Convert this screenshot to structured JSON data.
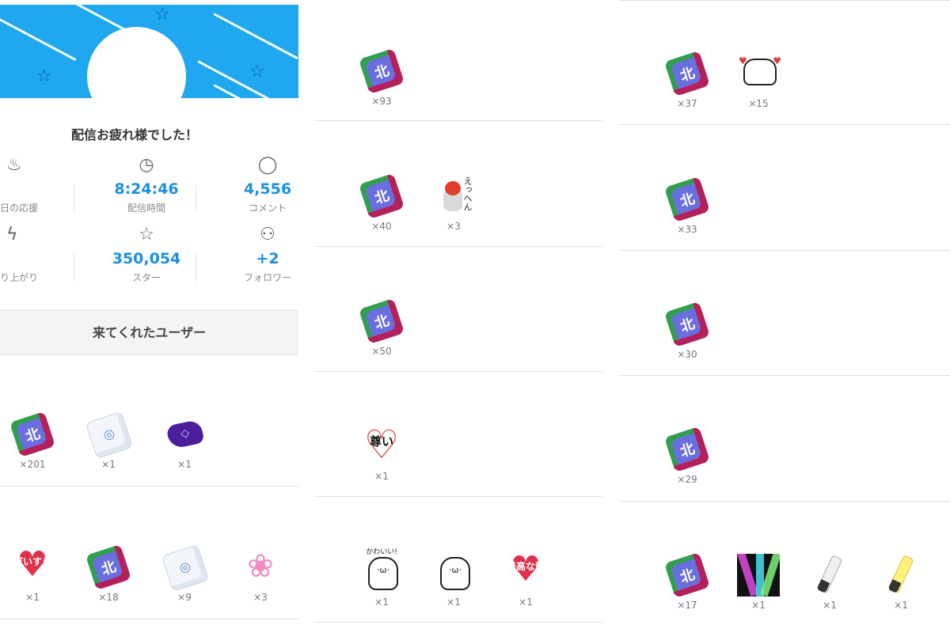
{
  "header": {
    "title": "配信お疲れ様でした！",
    "section_title": "来てくれたユーザー"
  },
  "stats": [
    {
      "icon": "flame-icon",
      "value": "",
      "label": "日の応援"
    },
    {
      "icon": "clock-icon",
      "value": "8:24:46",
      "label": "配信時間"
    },
    {
      "icon": "comment-icon",
      "value": "4,556",
      "label": "コメント"
    },
    {
      "icon": "bolt-icon",
      "value": "",
      "label": "り上がり"
    },
    {
      "icon": "star-icon",
      "value": "350,054",
      "label": "スター"
    },
    {
      "icon": "person-icon",
      "value": "+2",
      "label": "フォロワー"
    }
  ],
  "colors": {
    "banner": "#1fa7ef",
    "accent": "#1a8fe3"
  },
  "left_rows": [
    [
      {
        "type": "dice",
        "mark": "北",
        "count": "×201"
      },
      {
        "type": "dice-white",
        "count": "×1"
      },
      {
        "type": "pillow",
        "count": "×1"
      }
    ],
    [
      {
        "type": "heart-sticker",
        "text": "だいすき",
        "count": "×1"
      },
      {
        "type": "dice",
        "mark": "北",
        "count": "×18"
      },
      {
        "type": "dice-white",
        "count": "×9"
      },
      {
        "type": "lotus",
        "count": "×3"
      }
    ]
  ],
  "mid_rows": [
    [
      {
        "type": "dice",
        "mark": "北",
        "count": "×93"
      }
    ],
    [
      {
        "type": "dice",
        "mark": "北",
        "count": "×40"
      },
      {
        "type": "tengu",
        "text": "えっへん",
        "count": "×3"
      }
    ],
    [
      {
        "type": "dice",
        "mark": "北",
        "count": "×50"
      }
    ],
    [
      {
        "type": "heart-outline",
        "text": "尊い",
        "count": "×1"
      }
    ],
    [
      {
        "type": "cat-sticker",
        "text": "かわいい!",
        "count": "×1"
      },
      {
        "type": "cat-sticker",
        "text": "",
        "count": "×1"
      },
      {
        "type": "heart-sticker",
        "text": "最高な愛",
        "count": "×1"
      }
    ]
  ],
  "right_rows": [
    [
      {
        "type": "dice",
        "mark": "北",
        "count": "×37"
      },
      {
        "type": "cat-hearts",
        "count": "×15"
      }
    ],
    [
      {
        "type": "dice",
        "mark": "北",
        "count": "×33"
      }
    ],
    [
      {
        "type": "dice",
        "mark": "北",
        "count": "×30"
      }
    ],
    [
      {
        "type": "dice",
        "mark": "北",
        "count": "×29"
      }
    ],
    [
      {
        "type": "dice",
        "mark": "北",
        "count": "×17"
      },
      {
        "type": "light-show",
        "count": "×1"
      },
      {
        "type": "penlight-white",
        "count": "×1"
      },
      {
        "type": "penlight-yellow",
        "count": "×1"
      }
    ]
  ]
}
